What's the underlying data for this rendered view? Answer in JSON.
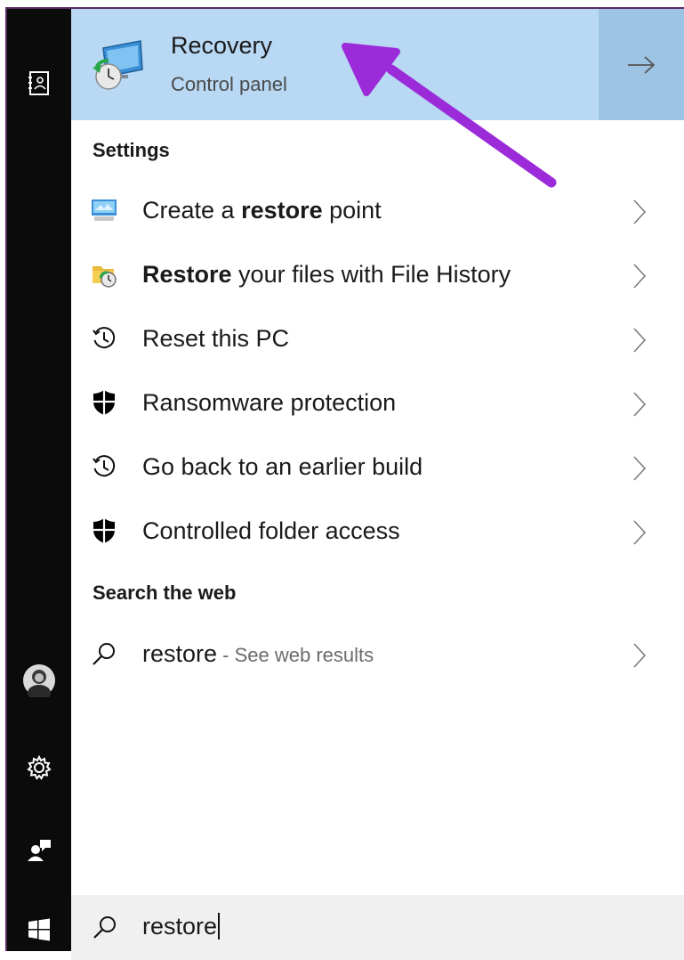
{
  "top_result": {
    "title": "Recovery",
    "subtitle": "Control panel",
    "icon": "recovery-icon",
    "open_icon": "arrow-right-icon"
  },
  "sections": {
    "settings": "Settings",
    "web": "Search the web"
  },
  "settings_items": [
    {
      "pre": "Create a ",
      "bold": "restore",
      "post": " point",
      "icon": "system-monitor-icon"
    },
    {
      "pre": "",
      "bold": "Restore",
      "post": " your files with File History",
      "icon": "file-history-icon"
    },
    {
      "pre": "Reset this PC",
      "bold": "",
      "post": "",
      "icon": "history-icon"
    },
    {
      "pre": "Ransomware protection",
      "bold": "",
      "post": "",
      "icon": "shield-icon"
    },
    {
      "pre": "Go back to an earlier build",
      "bold": "",
      "post": "",
      "icon": "history-icon"
    },
    {
      "pre": "Controlled folder access",
      "bold": "",
      "post": "",
      "icon": "shield-icon"
    }
  ],
  "web_result": {
    "query": "restore",
    "suffix": " - See web results",
    "icon": "search-icon"
  },
  "search_box": {
    "value": "restore",
    "icon": "search-icon"
  },
  "leftbar_icons": [
    "notebook-icon",
    "avatar",
    "gear-icon",
    "feedback-icon",
    "windows-start-icon"
  ],
  "colors": {
    "top_result_bg": "#b8d8f3",
    "top_result_arrow_bg": "#9ec4e4",
    "leftbar_bg": "#0b0b0b",
    "callout_arrow": "#9b2bd9"
  }
}
